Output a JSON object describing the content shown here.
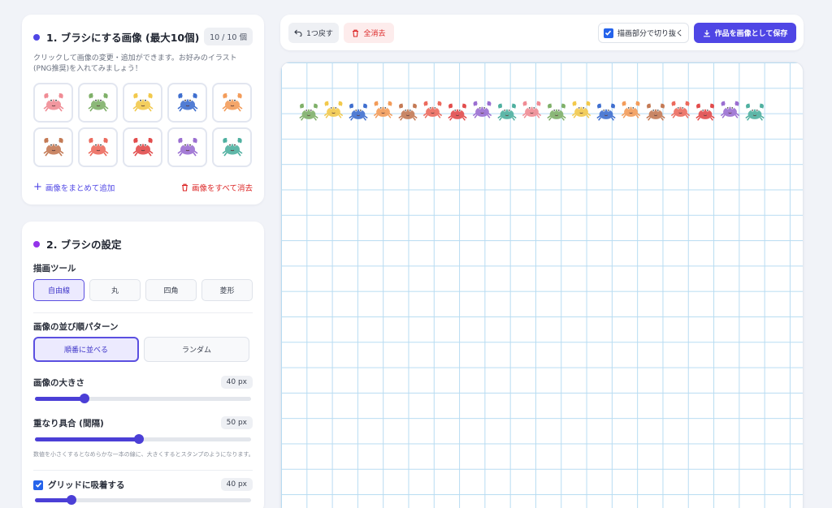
{
  "accent": "#4f46e5",
  "danger": "#dc2626",
  "images_panel": {
    "title": "1. ブラシにする画像 (最大10個)",
    "count": "10 / 10 個",
    "help": "クリックして画像の変更・追加ができます。お好みのイラスト(PNG推奨)を入れてみましょう！",
    "thumbnails": [
      {
        "icon": "crab-icon",
        "color": "#f08c95"
      },
      {
        "icon": "crab-icon",
        "color": "#7fb069"
      },
      {
        "icon": "crab-icon",
        "color": "#f2c94c"
      },
      {
        "icon": "crab-icon",
        "color": "#3f6fcf"
      },
      {
        "icon": "crab-icon",
        "color": "#f39c5a"
      },
      {
        "icon": "crab-icon",
        "color": "#c47a55"
      },
      {
        "icon": "crab-icon",
        "color": "#ec6b5e"
      },
      {
        "icon": "crab-icon",
        "color": "#e24c4c"
      },
      {
        "icon": "crab-icon",
        "color": "#9b6fd1"
      },
      {
        "icon": "crab-icon",
        "color": "#4fb0a0"
      }
    ],
    "add_label": "画像をまとめて追加",
    "clear_label": "画像をすべて消去"
  },
  "settings_panel": {
    "title": "2. ブラシの設定",
    "tool_label": "描画ツール",
    "tools": [
      "自由線",
      "丸",
      "四角",
      "菱形"
    ],
    "active_tool": 0,
    "order_label": "画像の並び順パターン",
    "orders": [
      "順番に並べる",
      "ランダム"
    ],
    "active_order": 0,
    "size_label": "画像の大きさ",
    "size_value": "40 px",
    "size_fraction": 0.23,
    "overlap_label": "重なり具合 (間隔)",
    "overlap_value": "50 px",
    "overlap_fraction": 0.48,
    "overlap_note": "数値を小さくするとなめらかな一本の線に、大きくするとスタンプのようになります。",
    "snap_label": "グリッドに吸着する",
    "snap_checked": true,
    "snap_value": "40 px",
    "snap_fraction": 0.17
  },
  "toolbar": {
    "undo_label": "1つ戻す",
    "clear_label": "全消去",
    "crop_label": "描画部分で切り抜く",
    "crop_checked": true,
    "save_label": "作品を画像として保存"
  },
  "canvas": {
    "grid_color": "#b8dcf2",
    "stamp_sequence": [
      "#7fb069",
      "#f2c94c",
      "#3f6fcf",
      "#f39c5a",
      "#c47a55",
      "#ec6b5e",
      "#e24c4c",
      "#9b6fd1",
      "#4fb0a0",
      "#f08c95",
      "#7fb069",
      "#f2c94c",
      "#3f6fcf",
      "#f39c5a",
      "#c47a55",
      "#ec6b5e",
      "#e24c4c",
      "#9b6fd1",
      "#4fb0a0"
    ]
  }
}
